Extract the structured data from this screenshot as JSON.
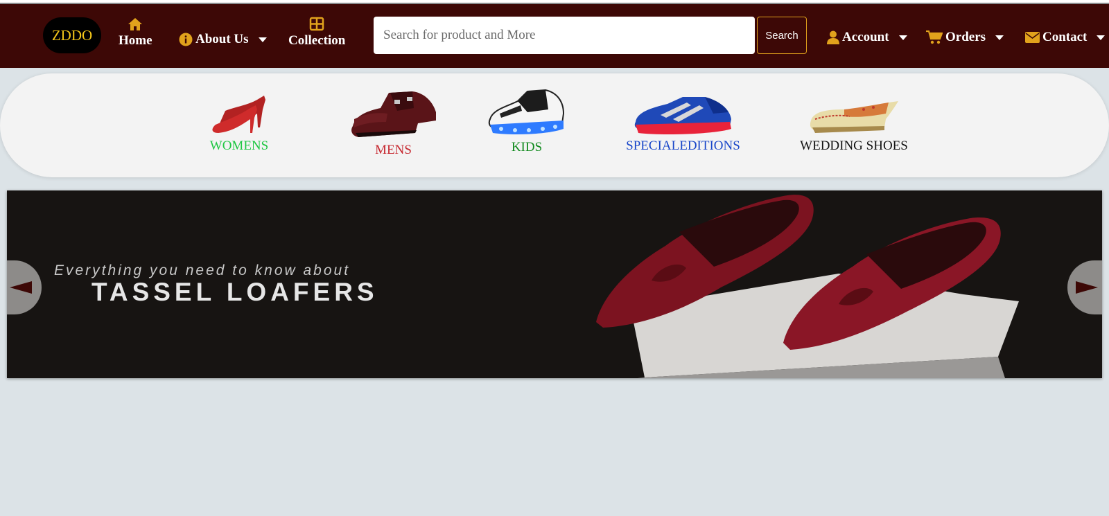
{
  "navbar": {
    "logo": "ZDDO",
    "home_label": "Home",
    "about_label": "About Us",
    "collection_label": "Collection",
    "search_placeholder": "Search for product and More",
    "search_button": "Search",
    "account_label": "Account",
    "orders_label": "Orders",
    "contact_label": "Contact",
    "icon_color": "#e1a21c",
    "background": "#3d0806"
  },
  "categories": [
    {
      "label": "WOMENS",
      "color": "#1ec742",
      "icon": "high-heel-shoe-icon"
    },
    {
      "label": "MENS",
      "color": "#c6262e",
      "icon": "monk-strap-shoe-icon"
    },
    {
      "label": "KIDS",
      "color": "#118a1e",
      "icon": "light-up-sneaker-icon"
    },
    {
      "label": "SPECIALEDITIONS",
      "color": "#1947c9",
      "icon": "running-shoe-icon"
    },
    {
      "label": "WEDDING SHOES",
      "color": "#111111",
      "icon": "embroidered-jutti-icon"
    }
  ],
  "carousel": {
    "subtitle": "Everything you need to know about",
    "title": "TASSEL LOAFERS"
  }
}
